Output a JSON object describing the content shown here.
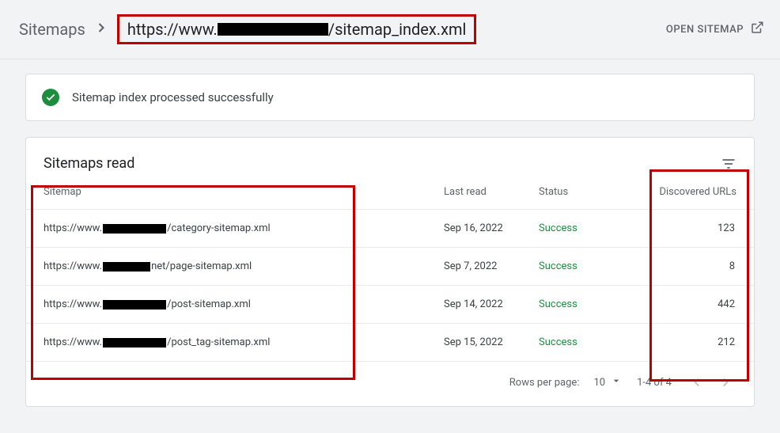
{
  "breadcrumb": {
    "root": "Sitemaps",
    "url_prefix": "https://www.",
    "url_suffix": "/sitemap_index.xml"
  },
  "header": {
    "open_sitemap": "OPEN SITEMAP"
  },
  "status_banner": {
    "message": "Sitemap index processed successfully"
  },
  "table": {
    "title": "Sitemaps read",
    "columns": {
      "sitemap": "Sitemap",
      "last_read": "Last read",
      "status": "Status",
      "discovered_urls": "Discovered URLs"
    },
    "rows": [
      {
        "url_prefix": "https://www.",
        "url_suffix": "/category-sitemap.xml",
        "last_read": "Sep 16, 2022",
        "status": "Success",
        "discovered_urls": 123
      },
      {
        "url_prefix": "https://www.",
        "url_mid_suffix": "net",
        "url_suffix": "/page-sitemap.xml",
        "last_read": "Sep 7, 2022",
        "status": "Success",
        "discovered_urls": 8
      },
      {
        "url_prefix": "https://www.",
        "url_suffix": "/post-sitemap.xml",
        "last_read": "Sep 14, 2022",
        "status": "Success",
        "discovered_urls": 442
      },
      {
        "url_prefix": "https://www.",
        "url_suffix": "/post_tag-sitemap.xml",
        "last_read": "Sep 15, 2022",
        "status": "Success",
        "discovered_urls": 212
      }
    ],
    "footer": {
      "rows_per_page_label": "Rows per page:",
      "rows_per_page_value": "10",
      "range": "1-4 of 4"
    }
  }
}
